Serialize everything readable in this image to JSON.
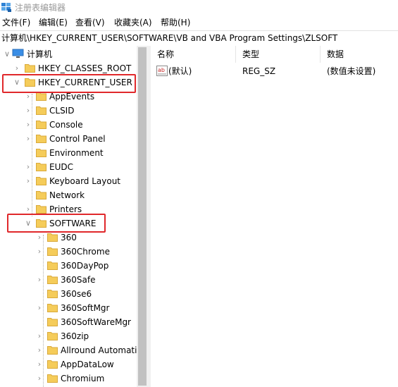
{
  "window": {
    "title": "注册表编辑器"
  },
  "menu": [
    "文件(F)",
    "编辑(E)",
    "查看(V)",
    "收藏夹(A)",
    "帮助(H)"
  ],
  "address": "计算机\\HKEY_CURRENT_USER\\SOFTWARE\\VB and VBA Program Settings\\ZLSOFT",
  "tree": {
    "root": "计算机",
    "hives": [
      "HKEY_CLASSES_ROOT",
      "HKEY_CURRENT_USER"
    ],
    "hkcu_children": [
      "AppEvents",
      "CLSID",
      "Console",
      "Control Panel",
      "Environment",
      "EUDC",
      "Keyboard Layout",
      "Network",
      "Printers",
      "SOFTWARE"
    ],
    "software_children": [
      "360",
      "360Chrome",
      "360DayPop",
      "360Safe",
      "360se6",
      "360SoftMgr",
      "360SoftWareMgr",
      "360zip",
      "Allround Automatio",
      "AppDataLow",
      "Chromium"
    ]
  },
  "values": {
    "columns": [
      "名称",
      "类型",
      "数据"
    ],
    "rows": [
      {
        "name": "(默认)",
        "type": "REG_SZ",
        "data": "(数值未设置)"
      }
    ]
  },
  "colors": {
    "folder": "#f5cc5a",
    "highlight": "#e0282b"
  }
}
